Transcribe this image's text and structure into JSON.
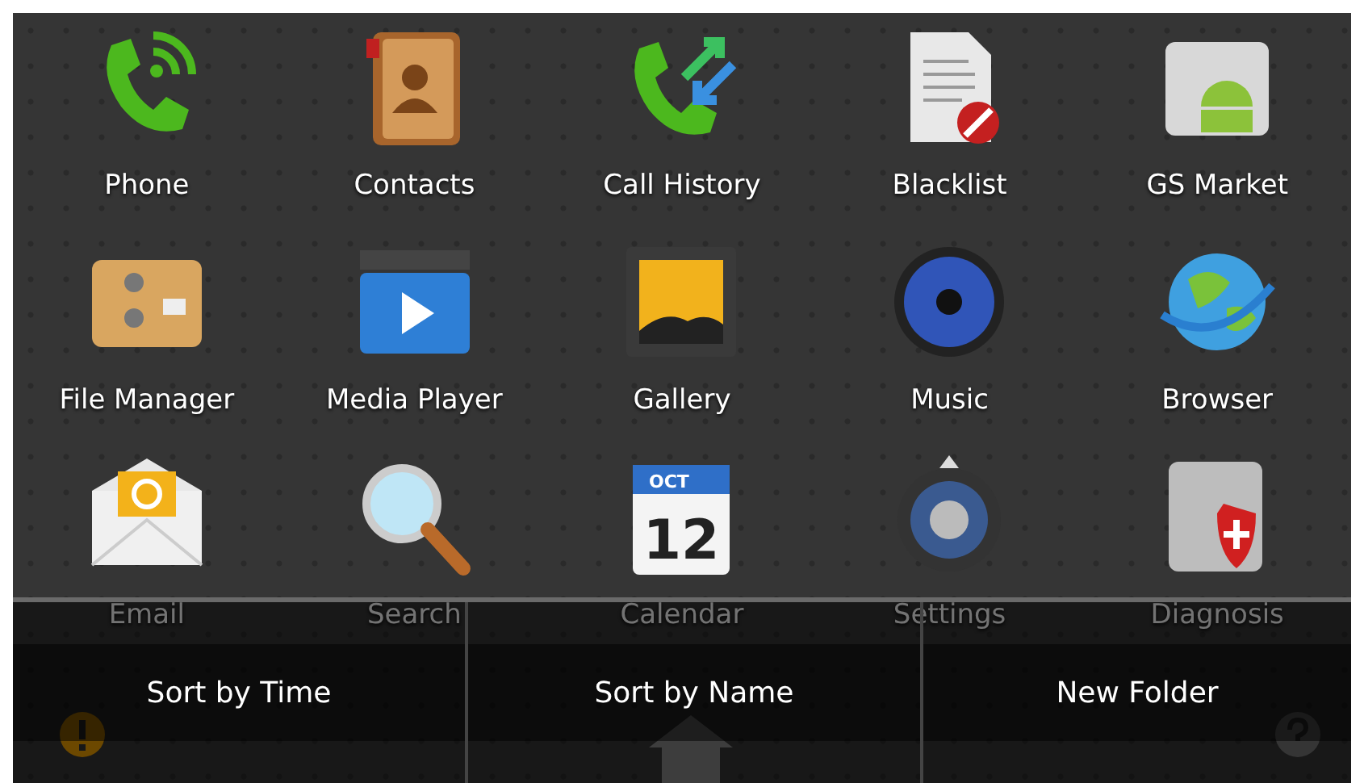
{
  "apps": [
    {
      "label": "Phone"
    },
    {
      "label": "Contacts"
    },
    {
      "label": "Call History"
    },
    {
      "label": "Blacklist"
    },
    {
      "label": "GS Market"
    },
    {
      "label": "File Manager"
    },
    {
      "label": "Media Player"
    },
    {
      "label": "Gallery"
    },
    {
      "label": "Music"
    },
    {
      "label": "Browser"
    },
    {
      "label": "Email"
    },
    {
      "label": "Search"
    },
    {
      "label": "Calendar",
      "month": "OCT",
      "day": "12"
    },
    {
      "label": "Settings"
    },
    {
      "label": "Diagnosis"
    }
  ],
  "menu": [
    "Sort by Time",
    "Sort by Name",
    "New Folder"
  ]
}
